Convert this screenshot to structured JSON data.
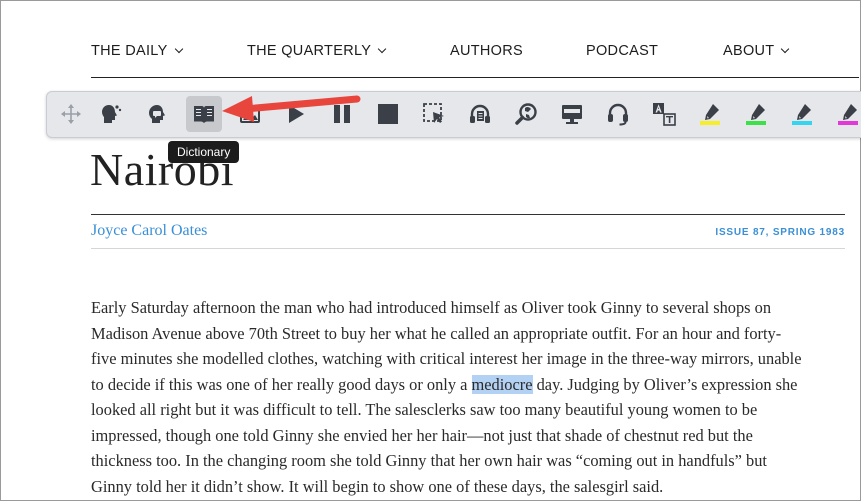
{
  "nav": {
    "items": [
      {
        "label": "THE DAILY",
        "dropdown": true
      },
      {
        "label": "THE QUARTERLY",
        "dropdown": true
      },
      {
        "label": "AUTHORS",
        "dropdown": false
      },
      {
        "label": "PODCAST",
        "dropdown": false
      },
      {
        "label": "ABOUT",
        "dropdown": true
      }
    ]
  },
  "toolbar": {
    "buttons": [
      {
        "icon": "move-handle-icon"
      },
      {
        "icon": "speak-head-icon"
      },
      {
        "icon": "chat-head-icon"
      },
      {
        "icon": "dictionary-icon",
        "active": true
      },
      {
        "icon": "picture-dictionary-icon"
      },
      {
        "icon": "play-icon"
      },
      {
        "icon": "pause-icon"
      },
      {
        "icon": "stop-icon"
      },
      {
        "icon": "screen-select-icon"
      },
      {
        "icon": "audio-maker-icon"
      },
      {
        "icon": "web-search-icon"
      },
      {
        "icon": "screen-mask-icon"
      },
      {
        "icon": "talk-type-icon"
      },
      {
        "icon": "translate-icon"
      },
      {
        "icon": "highlight-yellow-icon",
        "color": "#f7ee2a"
      },
      {
        "icon": "highlight-green-icon",
        "color": "#3ee04a"
      },
      {
        "icon": "highlight-cyan-icon",
        "color": "#35d5f0"
      },
      {
        "icon": "highlight-magenta-icon",
        "color": "#e238d8"
      }
    ],
    "tooltip": "Dictionary"
  },
  "article": {
    "title": "Nairobi",
    "author": "Joyce Carol Oates",
    "issue": "ISSUE 87, SPRING 1983",
    "lines": [
      {
        "text": "Early Saturday afternoon the man who had introduced himself as Oliver took Ginny to several shops on"
      },
      {
        "text": "Madison Avenue above 70th Street to buy her what he called an appropriate outfit. For an hour and forty-"
      },
      {
        "text": "five minutes she modelled clothes, watching with critical interest her image in the three-way mirrors, unable"
      },
      {
        "before": "to decide if this was one of her really good days or only a ",
        "highlight": "mediocre",
        "after": " day. Judging by Oliver’s expression she"
      },
      {
        "text": "looked all right but it was difficult to tell. The salesclerks saw too many beautiful young women to be"
      },
      {
        "text": "impressed, though one told Ginny she envied her her hair—not just that shade of chestnut red but the"
      },
      {
        "text": "thickness too. In the changing room she told Ginny that her own hair was “coming out in handfuls” but"
      },
      {
        "text": "Ginny told her it didn’t show. It will begin to show one of these days, the salesgirl said."
      }
    ]
  },
  "colors": {
    "accent_blue": "#3a8fd6",
    "selection": "#b3d1f3",
    "arrow_red": "#e8453c",
    "toolbar_bg": "#e5e7eb"
  }
}
